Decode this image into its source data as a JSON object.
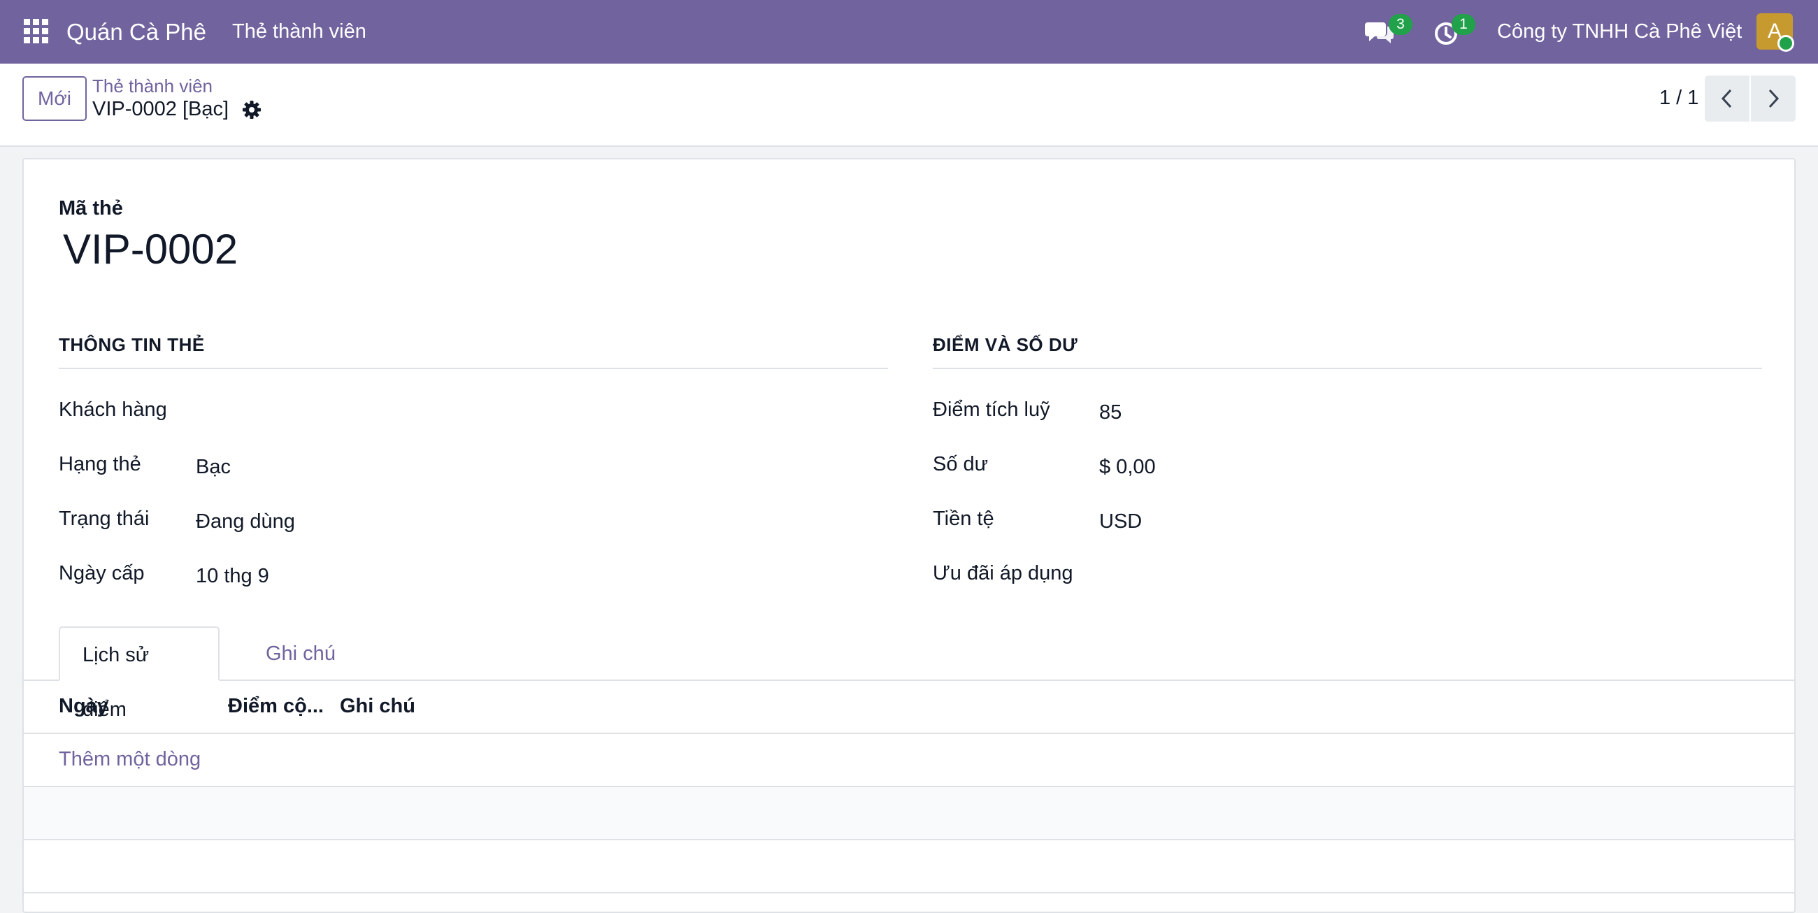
{
  "navbar": {
    "brand": "Quán Cà Phê",
    "menu_item": "Thẻ thành viên",
    "messages_count": "3",
    "activities_count": "1",
    "company": "Công ty TNHH Cà Phê Việt",
    "avatar_initial": "A",
    "color": "#71639e",
    "badge_color": "#21a24a"
  },
  "control": {
    "new_button": "Mới",
    "breadcrumb_parent": "Thẻ thành viên",
    "breadcrumb_current": "VIP-0002 [Bạc]",
    "pager": "1 / 1"
  },
  "form": {
    "code_label": "Mã thẻ",
    "code_value": "VIP-0002",
    "group_left": {
      "title": "THÔNG TIN THẺ",
      "fields": [
        {
          "label": "Khách hàng",
          "value": ""
        },
        {
          "label": "Hạng thẻ",
          "value": "Bạc"
        },
        {
          "label": "Trạng thái",
          "value": "Đang dùng"
        },
        {
          "label": "Ngày cấp",
          "value": "10 thg 9"
        }
      ]
    },
    "group_right": {
      "title": "ĐIỂM VÀ SỐ DƯ",
      "fields": [
        {
          "label": "Điểm tích luỹ",
          "value": "85"
        },
        {
          "label": "Số dư",
          "value": "$ 0,00"
        },
        {
          "label": "Tiền tệ",
          "value": "USD"
        },
        {
          "label": "Ưu đãi áp dụng",
          "value": ""
        }
      ]
    }
  },
  "tabs": [
    {
      "label": "Lịch sử điểm",
      "active": true
    },
    {
      "label": "Ghi chú",
      "active": false
    }
  ],
  "table": {
    "columns": [
      "Ngày",
      "Điểm cộ...",
      "Ghi chú"
    ],
    "add_line": "Thêm một dòng"
  }
}
